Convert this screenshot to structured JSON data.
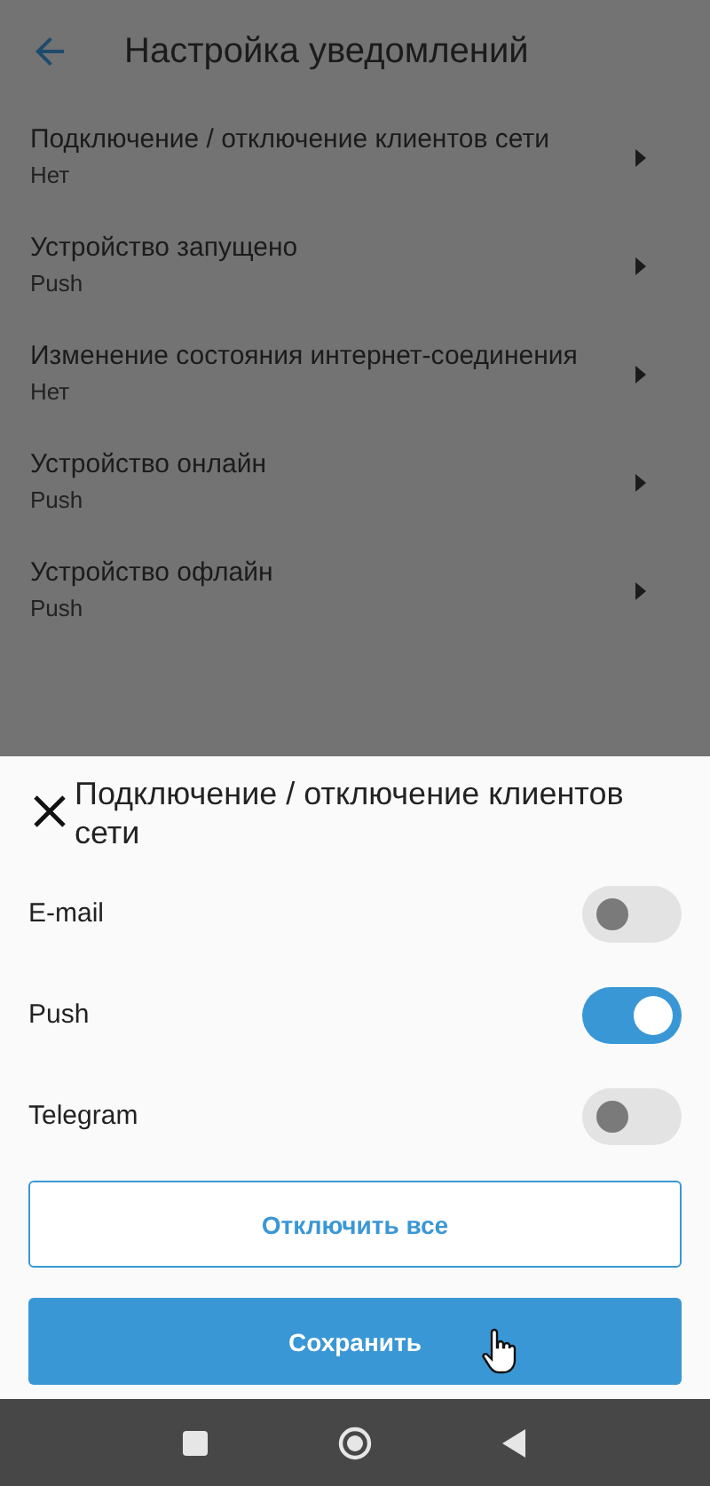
{
  "app_bar": {
    "title": "Настройка уведомлений"
  },
  "events": [
    {
      "title": "Подключение / отключение клиентов сети",
      "value": "Нет"
    },
    {
      "title": "Устройство запущено",
      "value": "Push"
    },
    {
      "title": "Изменение состояния интернет-соединения",
      "value": "Нет"
    },
    {
      "title": "Устройство онлайн",
      "value": "Push"
    },
    {
      "title": "Устройство офлайн",
      "value": "Push"
    }
  ],
  "sheet": {
    "title": "Подключение / отключение клиентов сети",
    "channels": [
      {
        "name": "E-mail",
        "on": false
      },
      {
        "name": "Push",
        "on": true
      },
      {
        "name": "Telegram",
        "on": false
      }
    ],
    "buttons": [
      {
        "label": "Отключить все",
        "kind": "outline"
      },
      {
        "label": "Сохранить",
        "kind": "filled"
      }
    ]
  }
}
